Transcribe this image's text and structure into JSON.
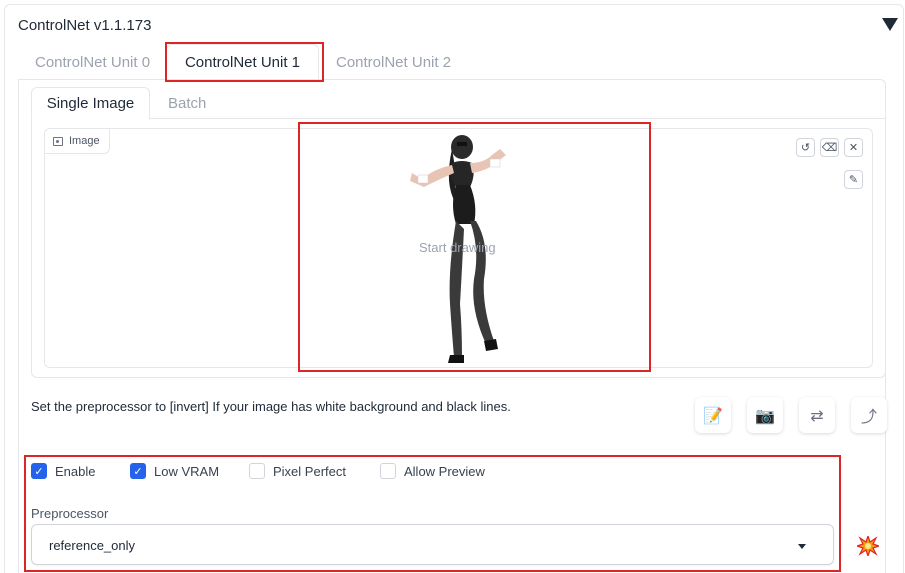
{
  "panel": {
    "title": "ControlNet v1.1.173",
    "collapse_icon": "triangle-down-icon"
  },
  "unit_tabs": [
    {
      "label": "ControlNet Unit 0",
      "active": false
    },
    {
      "label": "ControlNet Unit 1",
      "active": true
    },
    {
      "label": "ControlNet Unit 2",
      "active": false
    }
  ],
  "image_tabs": [
    {
      "label": "Single Image",
      "active": true
    },
    {
      "label": "Batch",
      "active": false
    }
  ],
  "image_input": {
    "label": "Image",
    "placeholder": "Start drawing",
    "tools": [
      "undo-icon",
      "eraser-icon",
      "close-icon",
      "brush-icon"
    ]
  },
  "hint_text": "Set the preprocessor to [invert] If your image has white background and black lines.",
  "action_buttons": [
    {
      "icon": "notepad-icon",
      "glyph": "📝"
    },
    {
      "icon": "camera-icon",
      "glyph": "📷"
    },
    {
      "icon": "swap-icon",
      "glyph": "⇄"
    },
    {
      "icon": "curved-arrow-icon",
      "glyph": "⤴"
    }
  ],
  "checkboxes": [
    {
      "label": "Enable",
      "checked": true
    },
    {
      "label": "Low VRAM",
      "checked": true
    },
    {
      "label": "Pixel Perfect",
      "checked": false
    },
    {
      "label": "Allow Preview",
      "checked": false
    }
  ],
  "preprocessor": {
    "label": "Preprocessor",
    "value": "reference_only",
    "run_icon": "explosion-icon"
  },
  "colors": {
    "highlight": "#dc2626",
    "checkbox": "#2563eb"
  }
}
